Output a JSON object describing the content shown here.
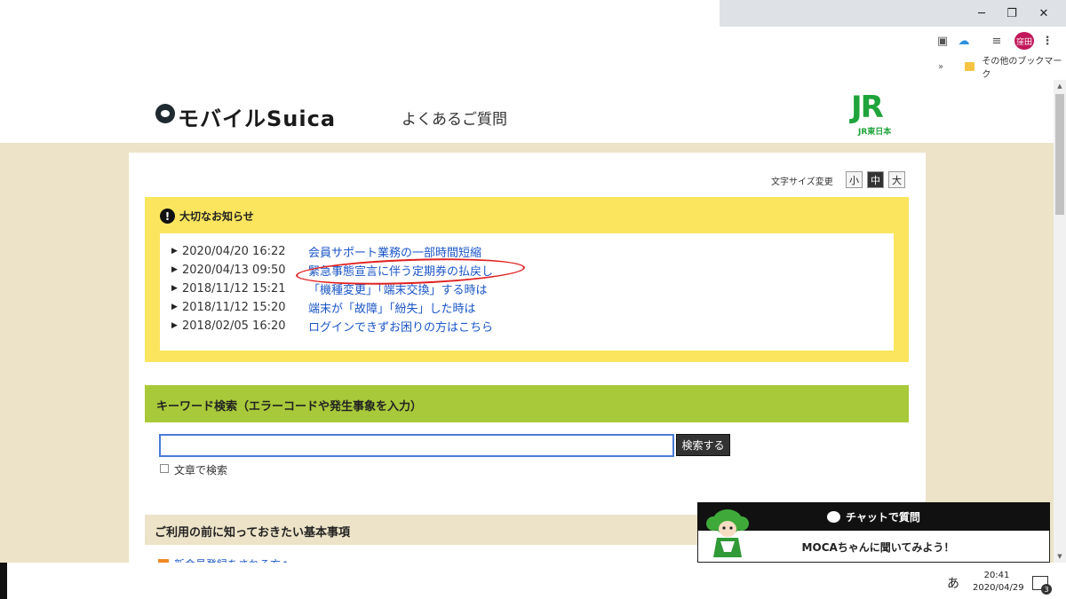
{
  "browser": {
    "window_controls": {
      "minimize": "─",
      "restore": "❐",
      "close": "✕"
    },
    "profile_avatar": "窪田",
    "bookmarks": {
      "other_bookmarks": "その他のブックマーク"
    }
  },
  "header": {
    "logo_text": "モバイルSuica",
    "page_title": "よくあるご質問",
    "jr_logo": "JR",
    "jr_sub": "JR東日本"
  },
  "font_size": {
    "label": "文字サイズ変更",
    "small": "小",
    "medium": "中",
    "large": "大"
  },
  "notice": {
    "title": "大切なお知らせ",
    "items": [
      {
        "date": "2020/04/20 16:22",
        "text": "会員サポート業務の一部時間短縮"
      },
      {
        "date": "2020/04/13 09:50",
        "text": "緊急事態宣言に伴う定期券の払戻し"
      },
      {
        "date": "2018/11/12 15:21",
        "text": "「機種変更」「端末交換」する時は"
      },
      {
        "date": "2018/11/12 15:20",
        "text": "端末が「故障」「紛失」した時は"
      },
      {
        "date": "2018/02/05 16:20",
        "text": "ログインできずお困りの方はこちら"
      }
    ]
  },
  "keyword_search": {
    "title": "キーワード検索（エラーコードや発生事象を入力）",
    "input_value": "",
    "button": "検索する",
    "checkbox_label": "文章で検索"
  },
  "basic": {
    "title": "ご利用の前に知っておきたい基本事項",
    "first_item": "新会員登録をされる方へ"
  },
  "chat": {
    "header": "チャットで質問",
    "body": "MOCAちゃんに聞いてみよう！"
  },
  "taskbar": {
    "ime": "あ",
    "time": "20:41",
    "date": "2020/04/29",
    "notifications": "3"
  },
  "colors": {
    "notice_bg": "#fbe55e",
    "keyword_bar": "#a8c93a",
    "page_bg": "#ece3c8",
    "link": "#1a56c8",
    "jr_green": "#1ea43a",
    "annotation_red": "#e02020"
  }
}
